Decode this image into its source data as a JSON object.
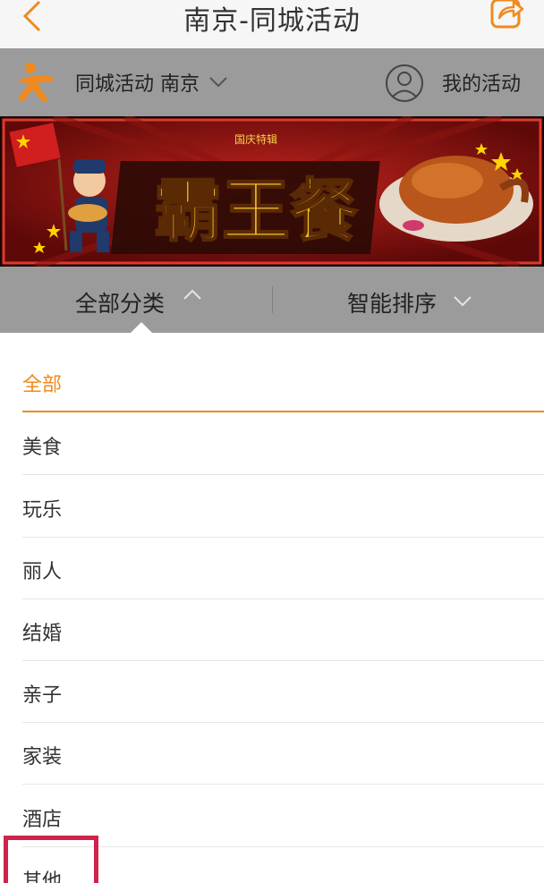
{
  "header": {
    "title": "南京-同城活动",
    "back_icon": "chevron-left-icon",
    "share_icon": "share-icon",
    "accent": "#f08a1e"
  },
  "subheader": {
    "city_label": "同城活动 南京",
    "my_activity": "我的活动"
  },
  "banner": {
    "tag": "国庆特辑",
    "headline": "霸王餐"
  },
  "filters": {
    "category": "全部分类",
    "sort": "智能排序"
  },
  "categories": [
    {
      "label": "全部",
      "active": true
    },
    {
      "label": "美食"
    },
    {
      "label": "玩乐"
    },
    {
      "label": "丽人"
    },
    {
      "label": "结婚"
    },
    {
      "label": "亲子"
    },
    {
      "label": "家装"
    },
    {
      "label": "酒店"
    },
    {
      "label": "其他"
    }
  ],
  "colors": {
    "orange": "#f08a1e",
    "highlight": "#d0234a",
    "header_gray": "#9b9b9b"
  }
}
